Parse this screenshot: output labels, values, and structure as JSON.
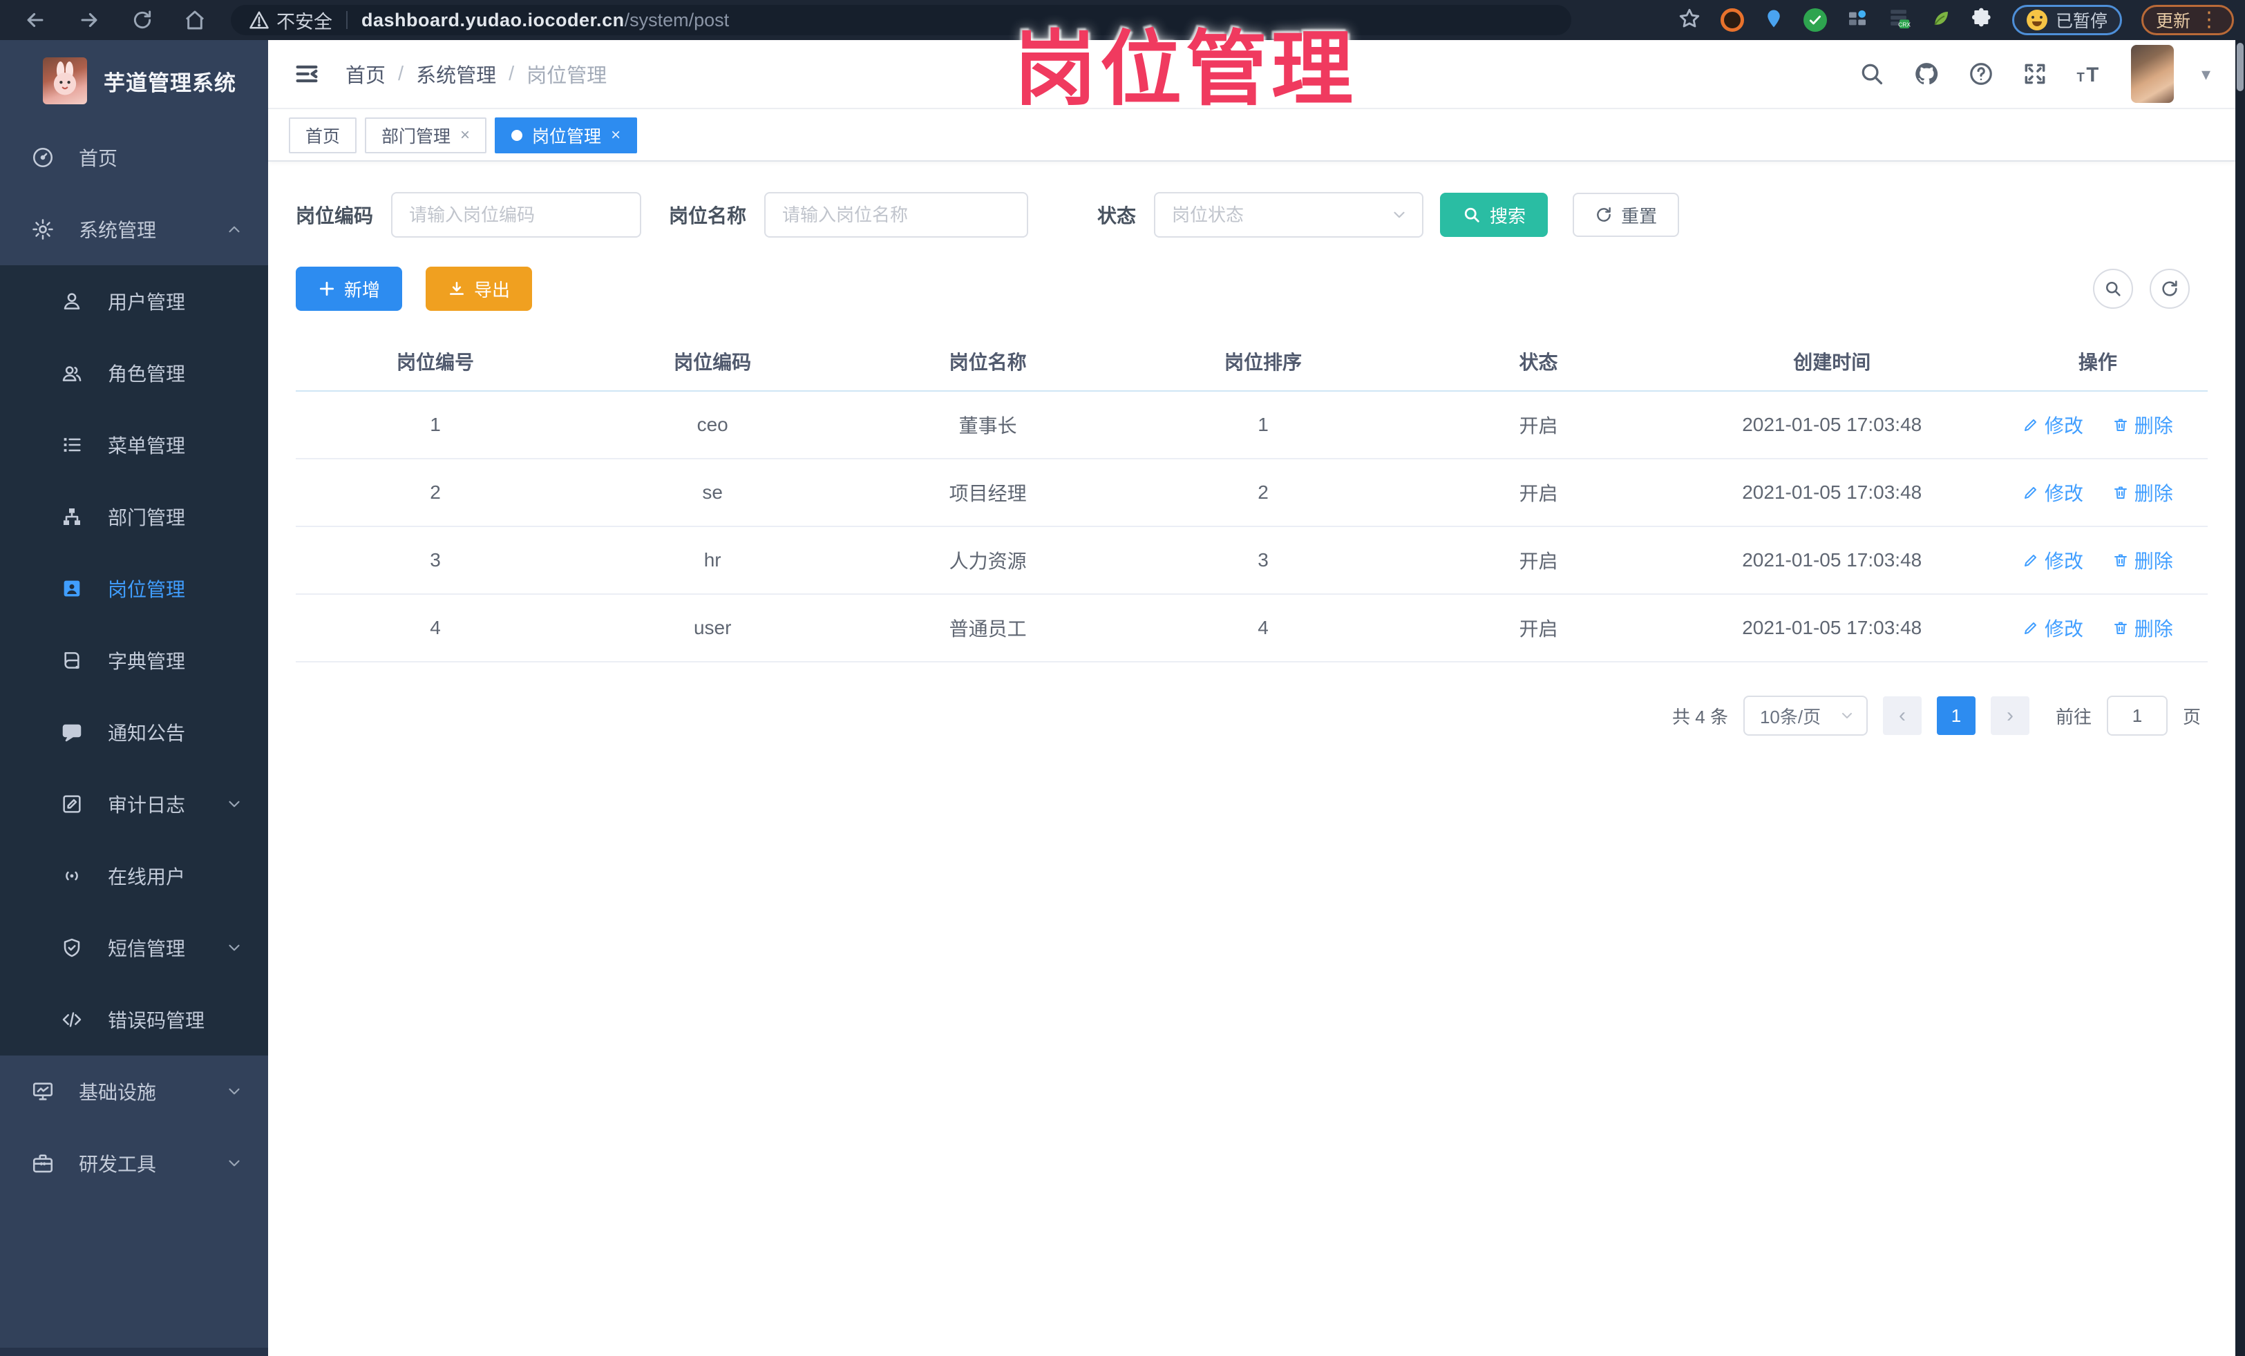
{
  "colors": {
    "accent_blue": "#2d8cf0",
    "link_blue": "#409eff",
    "search_teal": "#2abda3",
    "export_orange": "#f0a020",
    "overlay_pink": "#f03a5f",
    "sidebar_bg": "#32415a",
    "submenu_bg": "#1f2d3d"
  },
  "overlay_title": "岗位管理",
  "browser": {
    "security_label": "不安全",
    "url_host": "dashboard.yudao.iocoder.cn",
    "url_path": "/system/post",
    "paused_badge": "已暂停",
    "update_button": "更新",
    "kebab": "⋮"
  },
  "sidebar": {
    "app_title": "芋道管理系统",
    "items": [
      {
        "label": "首页"
      },
      {
        "label": "系统管理"
      },
      {
        "label": "用户管理"
      },
      {
        "label": "角色管理"
      },
      {
        "label": "菜单管理"
      },
      {
        "label": "部门管理"
      },
      {
        "label": "岗位管理"
      },
      {
        "label": "字典管理"
      },
      {
        "label": "通知公告"
      },
      {
        "label": "审计日志"
      },
      {
        "label": "在线用户"
      },
      {
        "label": "短信管理"
      },
      {
        "label": "错误码管理"
      },
      {
        "label": "基础设施"
      },
      {
        "label": "研发工具"
      }
    ]
  },
  "header": {
    "breadcrumb": [
      "首页",
      "系统管理",
      "岗位管理"
    ],
    "separator": "/"
  },
  "tabs": [
    {
      "label": "首页"
    },
    {
      "label": "部门管理",
      "close": "×"
    },
    {
      "label": "岗位管理",
      "close": "×"
    }
  ],
  "filters": {
    "code_label": "岗位编码",
    "code_placeholder": "请输入岗位编码",
    "name_label": "岗位名称",
    "name_placeholder": "请输入岗位名称",
    "status_label": "状态",
    "status_placeholder": "岗位状态",
    "search_label": "搜索",
    "reset_label": "重置"
  },
  "toolbar": {
    "add_label": "新增",
    "export_label": "导出"
  },
  "table": {
    "columns": [
      "岗位编号",
      "岗位编码",
      "岗位名称",
      "岗位排序",
      "状态",
      "创建时间",
      "操作"
    ],
    "edit_label": "修改",
    "delete_label": "删除",
    "rows": [
      {
        "id": "1",
        "code": "ceo",
        "name": "董事长",
        "sort": "1",
        "status": "开启",
        "created": "2021-01-05 17:03:48"
      },
      {
        "id": "2",
        "code": "se",
        "name": "项目经理",
        "sort": "2",
        "status": "开启",
        "created": "2021-01-05 17:03:48"
      },
      {
        "id": "3",
        "code": "hr",
        "name": "人力资源",
        "sort": "3",
        "status": "开启",
        "created": "2021-01-05 17:03:48"
      },
      {
        "id": "4",
        "code": "user",
        "name": "普通员工",
        "sort": "4",
        "status": "开启",
        "created": "2021-01-05 17:03:48"
      }
    ]
  },
  "pagination": {
    "total": "共 4 条",
    "page_size": "10条/页",
    "prev": "‹",
    "current": "1",
    "next": "›",
    "goto_label": "前往",
    "goto_value": "1",
    "goto_suffix": "页"
  }
}
